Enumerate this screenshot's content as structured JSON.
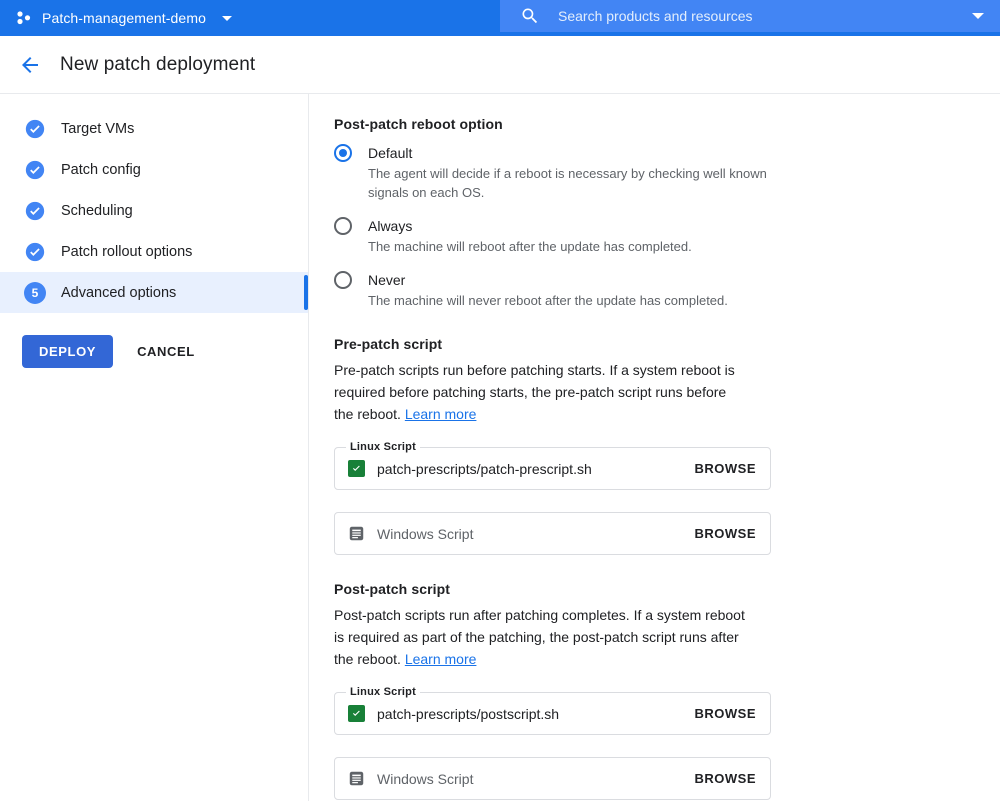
{
  "topbar": {
    "project_name": "Patch-management-demo",
    "project_icon": "project-dots-icon",
    "dropdown_icon": "chevron-down-icon",
    "search_placeholder": "Search products and resources",
    "search_value": "",
    "search_icon": "search-icon",
    "search_dropdown_icon": "chevron-down-icon",
    "bar_color": "#1a73e8",
    "search_color": "#4285f4"
  },
  "header": {
    "back_icon": "arrow-back-icon",
    "title": "New patch deployment"
  },
  "sidebar": {
    "steps": [
      {
        "label": "Target VMs",
        "state": "complete",
        "icon": "check-circle-icon"
      },
      {
        "label": "Patch config",
        "state": "complete",
        "icon": "check-circle-icon"
      },
      {
        "label": "Scheduling",
        "state": "complete",
        "icon": "check-circle-icon"
      },
      {
        "label": "Patch rollout options",
        "state": "complete",
        "icon": "check-circle-icon"
      },
      {
        "label": "Advanced options",
        "state": "active",
        "number": "5"
      }
    ],
    "deploy_label": "DEPLOY",
    "cancel_label": "CANCEL",
    "deploy_color": "#3367d6",
    "active_bg": "#e8f0fe",
    "active_bar_color": "#1a73e8"
  },
  "main": {
    "reboot": {
      "title": "Post-patch reboot option",
      "options": [
        {
          "label": "Default",
          "selected": true,
          "description": "The agent will decide if a reboot is necessary by checking well known signals on each OS."
        },
        {
          "label": "Always",
          "selected": false,
          "description": "The machine will reboot after the update has completed."
        },
        {
          "label": "Never",
          "selected": false,
          "description": "The machine will never reboot after the update has completed."
        }
      ]
    },
    "pre_patch": {
      "title": "Pre-patch script",
      "description": "Pre-patch scripts run before patching starts. If a system reboot is required before patching starts, the pre-patch script runs before the reboot.",
      "learn_more": "Learn more",
      "linux": {
        "legend": "Linux Script",
        "value": "patch-prescripts/patch-prescript.sh",
        "icon": "green-check-icon",
        "browse_label": "BROWSE"
      },
      "windows": {
        "legend": "",
        "placeholder": "Windows Script",
        "value": "",
        "icon": "document-icon",
        "browse_label": "BROWSE"
      }
    },
    "post_patch": {
      "title": "Post-patch script",
      "description": "Post-patch scripts run after patching completes. If a system reboot is required as part of the patching, the post-patch script runs after the reboot.",
      "learn_more": "Learn more",
      "linux": {
        "legend": "Linux Script",
        "value": "patch-prescripts/postscript.sh",
        "icon": "green-check-icon",
        "browse_label": "BROWSE"
      },
      "windows": {
        "legend": "",
        "placeholder": "Windows Script",
        "value": "",
        "icon": "document-icon",
        "browse_label": "BROWSE"
      }
    }
  }
}
